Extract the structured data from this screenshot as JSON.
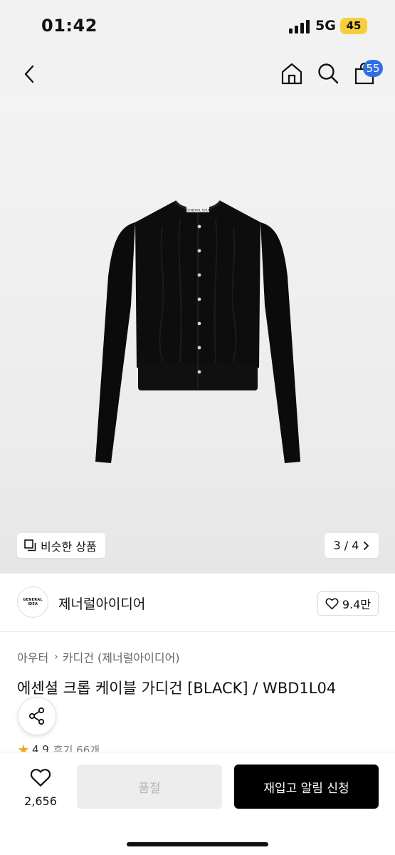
{
  "status_bar": {
    "time": "01:42",
    "network": "5G",
    "battery": "45"
  },
  "nav": {
    "cart_badge": "55",
    "icons": [
      "back-icon",
      "home-icon",
      "search-icon",
      "shopping-bag-icon"
    ]
  },
  "gallery": {
    "similar_label": "비슷한 상품",
    "pager": "3 / 4",
    "garment_tag": "GENERAL IDEA"
  },
  "brand": {
    "logo_text": "GENERAL IDEA",
    "name": "제너럴아이디어",
    "likes": "9.4만"
  },
  "product": {
    "breadcrumb": [
      "아우터",
      "카디건 (제너럴아이디어)"
    ],
    "title": "에센셜 크롭 케이블 가디건 [BLACK] / WBD1L04",
    "rating": "4.9",
    "reviews": "후기 66개"
  },
  "bottom_bar": {
    "wish_count": "2,656",
    "soldout_label": "품절",
    "restock_label": "재입고 알림 신청"
  },
  "colors": {
    "accent_badge": "#2f6fe6",
    "battery": "#f7cf3b",
    "star": "#f5a623",
    "primary_button": "#000000"
  }
}
